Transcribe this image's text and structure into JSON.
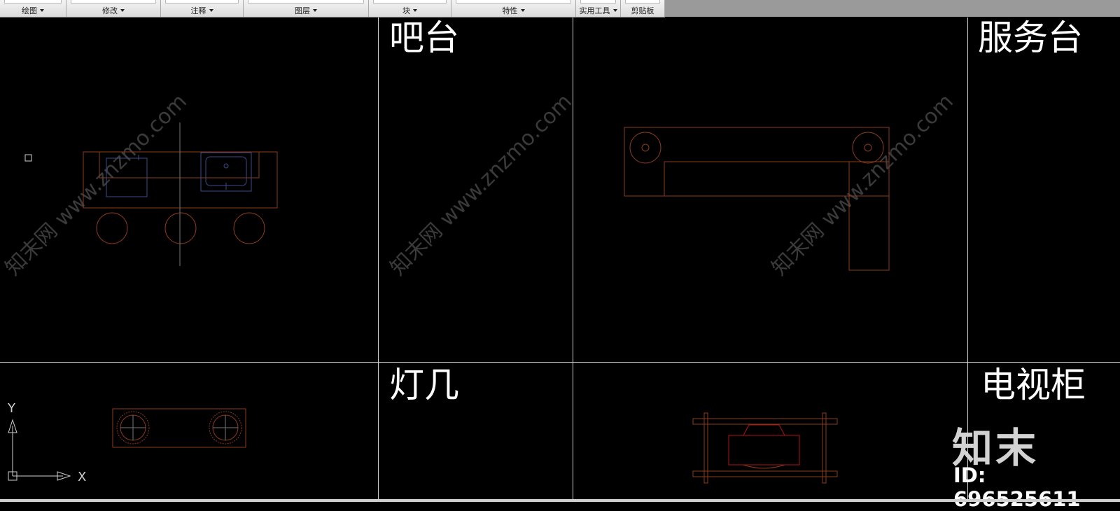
{
  "ribbon": {
    "panels": [
      {
        "label": "绘图",
        "has_menu": true
      },
      {
        "label": "修改",
        "has_menu": true
      },
      {
        "label": "注释",
        "has_menu": true
      },
      {
        "label": "图层",
        "has_menu": true
      },
      {
        "label": "块",
        "has_menu": true
      },
      {
        "label": "特性",
        "has_menu": true
      },
      {
        "label": "实用工具",
        "has_menu": true
      },
      {
        "label": "剪贴板",
        "has_menu": false
      }
    ]
  },
  "drawing": {
    "labels": {
      "bar_counter": "吧台",
      "service_desk": "服务台",
      "side_table": "灯几",
      "tv_cabinet": "电视柜"
    },
    "ucs": {
      "x_axis": "X",
      "y_axis": "Y"
    },
    "watermark_text": "知末网 www.znzmo.com",
    "colors": {
      "background": "#000000",
      "grid": "#cfcfcf",
      "furniture": "#8a3b1c",
      "fixture": "#3b4a8a",
      "label": "#ffffff"
    }
  },
  "branding": {
    "logo_text": "知末",
    "id_text": "ID: 696525611"
  }
}
